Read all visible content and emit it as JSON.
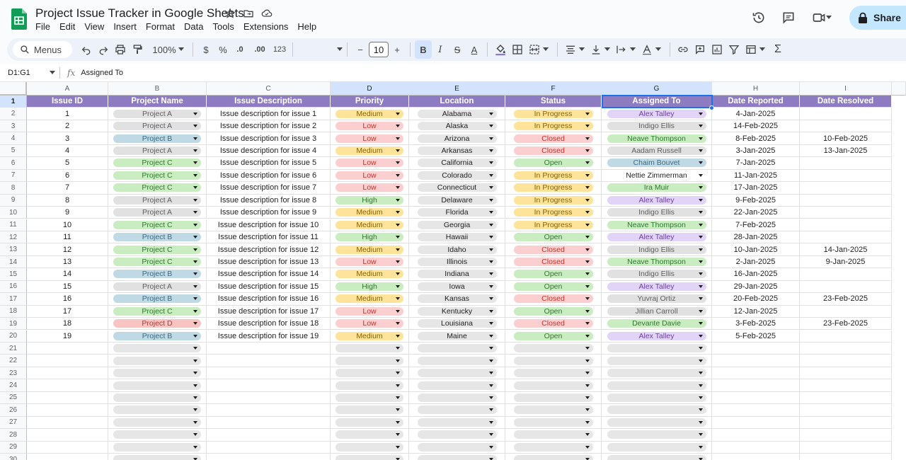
{
  "app": {
    "doc_title": "Project Issue Tracker in Google Sheets",
    "menu": [
      "File",
      "Edit",
      "View",
      "Insert",
      "Format",
      "Data",
      "Tools",
      "Extensions",
      "Help"
    ],
    "share_label": "Share",
    "icons": {
      "logo": "sheets-logo-icon",
      "star": "star-icon",
      "move": "folder-move-icon",
      "cloud": "cloud-status-icon",
      "history": "history-icon",
      "comments": "comment-icon",
      "meet": "video-call-icon",
      "share": "lock-icon"
    }
  },
  "toolbar": {
    "search_label": "Menus",
    "zoom": "100%",
    "currency": "$",
    "percent": "%",
    "dec_decrease": ".0",
    "dec_increase": ".00",
    "number_format": "123",
    "font_size": "10",
    "minus": "−",
    "plus": "+",
    "bold": "B",
    "italic": "I",
    "strike": "S",
    "text_color": "A",
    "function": "Σ"
  },
  "formula_bar": {
    "name_box": "D1:G1",
    "fx": "fx",
    "content": "Assigned To"
  },
  "columns": [
    "A",
    "B",
    "C",
    "D",
    "E",
    "F",
    "G",
    "H",
    "I"
  ],
  "headers": [
    "Issue ID",
    "Project Name",
    "Issue Description",
    "Priority",
    "Location",
    "Status",
    "Assigned To",
    "Date Reported",
    "Date Resolved"
  ],
  "rows": [
    {
      "id": "1",
      "project": "Project A",
      "desc": "Issue description for issue 1",
      "priority": "Medium",
      "location": "Alabama",
      "status": "In Progress",
      "assigned": "Alex Talley",
      "reported": "4-Jan-2025",
      "resolved": ""
    },
    {
      "id": "2",
      "project": "Project A",
      "desc": "Issue description for issue 2",
      "priority": "Low",
      "location": "Alaska",
      "status": "In Progress",
      "assigned": "Indigo Ellis",
      "reported": "14-Feb-2025",
      "resolved": ""
    },
    {
      "id": "3",
      "project": "Project B",
      "desc": "Issue description for issue 3",
      "priority": "Low",
      "location": "Arizona",
      "status": "Closed",
      "assigned": "Neave Thompson",
      "reported": "8-Feb-2025",
      "resolved": "10-Feb-2025"
    },
    {
      "id": "4",
      "project": "Project A",
      "desc": "Issue description for issue 4",
      "priority": "Medium",
      "location": "Arkansas",
      "status": "Closed",
      "assigned": "Aadam Russell",
      "reported": "3-Jan-2025",
      "resolved": "13-Jan-2025"
    },
    {
      "id": "5",
      "project": "Project C",
      "desc": "Issue description for issue 5",
      "priority": "Low",
      "location": "California",
      "status": "Open",
      "assigned": "Chaim Bouvet",
      "reported": "7-Jan-2025",
      "resolved": ""
    },
    {
      "id": "6",
      "project": "Project C",
      "desc": "Issue description for issue 6",
      "priority": "Low",
      "location": "Colorado",
      "status": "In Progress",
      "assigned": "Nettie Zimmerman",
      "reported": "11-Jan-2025",
      "resolved": ""
    },
    {
      "id": "7",
      "project": "Project C",
      "desc": "Issue description for issue 7",
      "priority": "Low",
      "location": "Connecticut",
      "status": "In Progress",
      "assigned": "Ira Muir",
      "reported": "17-Jan-2025",
      "resolved": ""
    },
    {
      "id": "8",
      "project": "Project A",
      "desc": "Issue description for issue 8",
      "priority": "High",
      "location": "Delaware",
      "status": "In Progress",
      "assigned": "Alex Talley",
      "reported": "9-Feb-2025",
      "resolved": ""
    },
    {
      "id": "9",
      "project": "Project A",
      "desc": "Issue description for issue 9",
      "priority": "Medium",
      "location": "Florida",
      "status": "In Progress",
      "assigned": "Indigo Ellis",
      "reported": "22-Jan-2025",
      "resolved": ""
    },
    {
      "id": "10",
      "project": "Project C",
      "desc": "Issue description for issue 10",
      "priority": "Medium",
      "location": "Georgia",
      "status": "In Progress",
      "assigned": "Neave Thompson",
      "reported": "7-Feb-2025",
      "resolved": ""
    },
    {
      "id": "11",
      "project": "Project B",
      "desc": "Issue description for issue 11",
      "priority": "High",
      "location": "Hawaii",
      "status": "Open",
      "assigned": "Alex Talley",
      "reported": "28-Jan-2025",
      "resolved": ""
    },
    {
      "id": "12",
      "project": "Project C",
      "desc": "Issue description for issue 12",
      "priority": "Medium",
      "location": "Idaho",
      "status": "Closed",
      "assigned": "Indigo Ellis",
      "reported": "10-Jan-2025",
      "resolved": "14-Jan-2025"
    },
    {
      "id": "13",
      "project": "Project C",
      "desc": "Issue description for issue 13",
      "priority": "Low",
      "location": "Illinois",
      "status": "Closed",
      "assigned": "Neave Thompson",
      "reported": "2-Jan-2025",
      "resolved": "9-Jan-2025"
    },
    {
      "id": "14",
      "project": "Project B",
      "desc": "Issue description for issue 14",
      "priority": "Medium",
      "location": "Indiana",
      "status": "Open",
      "assigned": "Indigo Ellis",
      "reported": "16-Jan-2025",
      "resolved": ""
    },
    {
      "id": "15",
      "project": "Project A",
      "desc": "Issue description for issue 15",
      "priority": "High",
      "location": "Iowa",
      "status": "Open",
      "assigned": "Alex Talley",
      "reported": "29-Jan-2025",
      "resolved": ""
    },
    {
      "id": "16",
      "project": "Project B",
      "desc": "Issue description for issue 16",
      "priority": "Medium",
      "location": "Kansas",
      "status": "Closed",
      "assigned": "Yuvraj Ortiz",
      "reported": "20-Feb-2025",
      "resolved": "23-Feb-2025"
    },
    {
      "id": "17",
      "project": "Project C",
      "desc": "Issue description for issue 17",
      "priority": "Low",
      "location": "Kentucky",
      "status": "Open",
      "assigned": "Jillian Carroll",
      "reported": "12-Jan-2025",
      "resolved": ""
    },
    {
      "id": "18",
      "project": "Project D",
      "desc": "Issue description for issue 18",
      "priority": "Low",
      "location": "Louisiana",
      "status": "Closed",
      "assigned": "Devante Davie",
      "reported": "3-Feb-2025",
      "resolved": "23-Feb-2025"
    },
    {
      "id": "19",
      "project": "Project B",
      "desc": "Issue description for issue 19",
      "priority": "Medium",
      "location": "Maine",
      "status": "Open",
      "assigned": "Alex Talley",
      "reported": "5-Feb-2025",
      "resolved": ""
    }
  ],
  "row_numbers": [
    "1",
    "2",
    "3",
    "4",
    "5",
    "6",
    "7",
    "8",
    "9",
    "10",
    "11",
    "12",
    "13",
    "14",
    "15",
    "16",
    "17",
    "18",
    "19",
    "20",
    "21",
    "22",
    "23",
    "24",
    "25",
    "26",
    "27",
    "28",
    "29",
    "30"
  ],
  "colors": {
    "header_bg": "#8e7cc3",
    "project": {
      "Project A": "#e1e1e1",
      "Project B": "#bfd9e5",
      "Project C": "#c9ecc1",
      "Project D": "#f8c4c2"
    },
    "project_text": {
      "Project A": "#5f5f5f",
      "Project B": "#3d6c82",
      "Project C": "#2f7a2f",
      "Project D": "#b03a36"
    },
    "priority": {
      "Medium": "#fde49a",
      "Low": "#fbcfcf",
      "High": "#c9ecc1"
    },
    "priority_text": {
      "Medium": "#8a6200",
      "Low": "#c0362c",
      "High": "#2f7a2f"
    },
    "status": {
      "In Progress": "#fde49a",
      "Closed": "#fbcfcf",
      "Open": "#c9ecc1"
    },
    "status_text": {
      "In Progress": "#8a6200",
      "Closed": "#c0362c",
      "Open": "#2f7a2f"
    },
    "location": "#e6e6e6",
    "assigned": {
      "Alex Talley": "#e2d4f6",
      "Indigo Ellis": "#e1e1e1",
      "Neave Thompson": "#c9ecc1",
      "Aadam Russell": "#e1e1e1",
      "Chaim Bouvet": "#bfd9e5",
      "Nettie Zimmerman": "#ffffff",
      "Ira Muir": "#c9ecc1",
      "Yuvraj Ortiz": "#e1e1e1",
      "Jillian Carroll": "#e1e1e1",
      "Devante Davie": "#c9ecc1"
    },
    "assigned_text": {
      "Alex Talley": "#6b3fa0",
      "Indigo Ellis": "#5f5f5f",
      "Neave Thompson": "#2f7a2f",
      "Aadam Russell": "#5f5f5f",
      "Chaim Bouvet": "#3d6c82",
      "Nettie Zimmerman": "#1f1f1f",
      "Ira Muir": "#2f7a2f",
      "Yuvraj Ortiz": "#5f5f5f",
      "Jillian Carroll": "#5f5f5f",
      "Devante Davie": "#2f7a2f"
    }
  }
}
